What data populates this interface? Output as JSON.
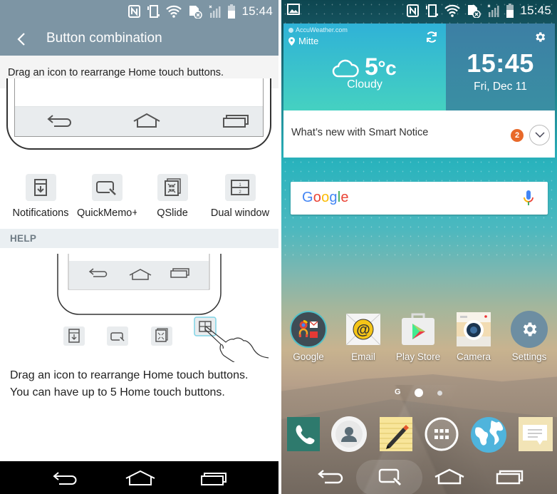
{
  "left_screen": {
    "status_bar": {
      "time": "15:44",
      "icons": [
        "nfc-icon",
        "vibrate-icon",
        "wifi-icon",
        "no-sim-icon",
        "signal-icon",
        "battery-icon"
      ]
    },
    "app_bar": {
      "title": "Button combination",
      "back_icon": "chevron-left-icon"
    },
    "instruction": "Drag an icon to rearrange Home touch buttons.",
    "preview_nav_buttons": [
      "back-icon",
      "home-icon",
      "recents-icon"
    ],
    "available_buttons": [
      {
        "label": "Notifications",
        "icon": "notifications-icon"
      },
      {
        "label": "QuickMemo+",
        "icon": "quickmemo-icon"
      },
      {
        "label": "QSlide",
        "icon": "qslide-icon"
      },
      {
        "label": "Dual window",
        "icon": "dual-window-icon"
      }
    ],
    "help": {
      "header": "HELP",
      "text_line1": "Drag an icon to rearrange Home touch buttons.",
      "text_line2": "You can have up to 5 Home touch buttons."
    },
    "nav_bar": [
      "back-icon",
      "home-icon",
      "recents-icon"
    ]
  },
  "right_screen": {
    "status_bar": {
      "time": "15:45",
      "left_icon": "gallery-icon",
      "icons": [
        "nfc-icon",
        "vibrate-icon",
        "wifi-icon",
        "no-sim-icon",
        "signal-icon",
        "battery-icon"
      ]
    },
    "weather_widget": {
      "provider": "AccuWeather.com",
      "location": "Mitte",
      "temperature": "5",
      "unit": "°c",
      "condition": "Cloudy"
    },
    "clock_widget": {
      "time": "15:45",
      "date": "Fri, Dec 11"
    },
    "smart_notice": {
      "text": "What’s new with Smart Notice",
      "badge": "2"
    },
    "search_bar": {
      "logo": "Google",
      "mic_icon": "microphone-icon"
    },
    "apps": [
      {
        "label": "Google",
        "icon": "google-folder-icon"
      },
      {
        "label": "Email",
        "icon": "email-icon"
      },
      {
        "label": "Play Store",
        "icon": "play-store-icon"
      },
      {
        "label": "Camera",
        "icon": "camera-icon"
      },
      {
        "label": "Settings",
        "icon": "settings-icon"
      }
    ],
    "pager": {
      "google_page": "G",
      "pages": 2,
      "current": 1
    },
    "dock": [
      "phone-icon",
      "contacts-icon",
      "memo-icon",
      "apps-drawer-icon",
      "browser-icon",
      "messaging-icon"
    ],
    "nav_bar": [
      "back-icon",
      "quickmemo-icon",
      "home-icon",
      "recents-icon"
    ]
  },
  "colors": {
    "left_header": "#7d95a4",
    "weather_top": "#2fb2d7",
    "weather_bottom": "#45d1c1",
    "clock_bg": "#3c7fa4",
    "notice_badge": "#e8692a"
  }
}
